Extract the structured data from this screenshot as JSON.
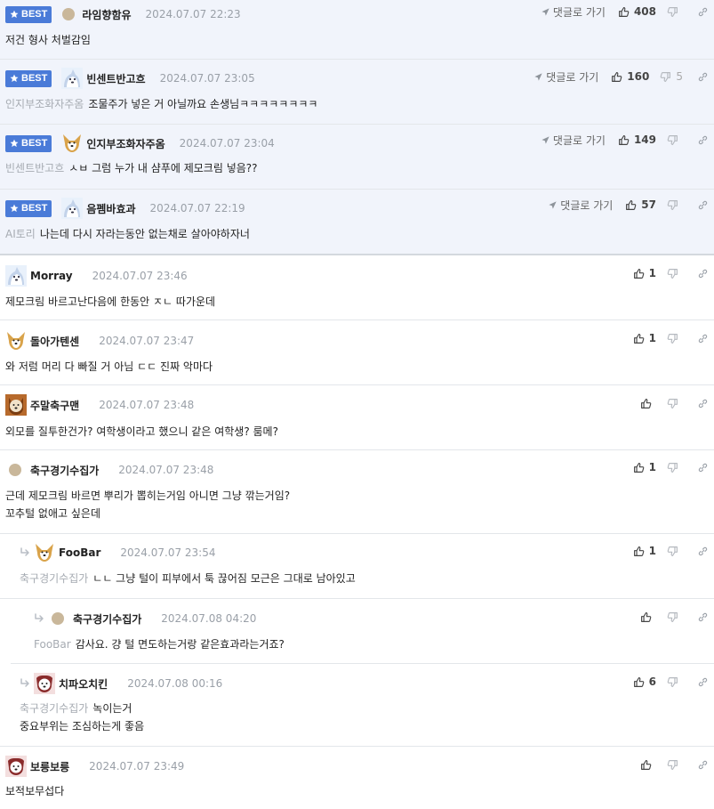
{
  "labels": {
    "best": "BEST",
    "reply_to": "댓글로 가기"
  },
  "colors": {
    "best_bg": "#f1f4fb",
    "best_badge": "#4a7bd8",
    "mention": "#a6abb2",
    "date": "#9aa0a8"
  },
  "comments": [
    {
      "best": true,
      "avatar": "dot-avatar",
      "nick": "라임향함유",
      "date": "2024.07.07 22:23",
      "likes": "408",
      "dislikes": "",
      "mention": "",
      "text": "저건 형사 처벌감임"
    },
    {
      "best": true,
      "avatar": "dog-white-icon",
      "nick": "빈센트반고흐",
      "date": "2024.07.07 23:05",
      "likes": "160",
      "dislikes": "5",
      "mention": "인지부조화자주옴",
      "text": "조물주가 넣은 거 아닐까요 손생님ㅋㅋㅋㅋㅋㅋㅋㅋ"
    },
    {
      "best": true,
      "avatar": "dog-yellow-icon",
      "nick": "인지부조화자주옴",
      "date": "2024.07.07 23:04",
      "likes": "149",
      "dislikes": "",
      "mention": "빈센트반고흐",
      "text": "ㅅㅂ 그럼 누가 내 샴푸에 제모크림 넣음??"
    },
    {
      "best": true,
      "avatar": "dog-white-icon",
      "nick": "음펨바효과",
      "date": "2024.07.07 22:19",
      "likes": "57",
      "dislikes": "",
      "mention": "AI토리",
      "text": "나는데 다시 자라는동안 없는채로 살아야하자너"
    },
    {
      "best": false,
      "avatar": "dog-white-icon",
      "nick": "Morray",
      "date": "2024.07.07 23:46",
      "likes": "1",
      "mention": "",
      "text": "제모크림 바르고난다음에 한동안 ㅈㄴ 따가운데"
    },
    {
      "best": false,
      "avatar": "dog-yellow-icon",
      "nick": "돌아가텐센",
      "date": "2024.07.07 23:47",
      "likes": "1",
      "mention": "",
      "text": "와 저럼 머리 다 빠질 거 아님 ㄷㄷ 진짜 악마다"
    },
    {
      "best": false,
      "avatar": "dog-brown-icon",
      "nick": "주말축구맨",
      "date": "2024.07.07 23:48",
      "likes": "",
      "mention": "",
      "text": "외모를 질투한건가? 여학생이라고 했으니 같은 여학생? 룸메?"
    },
    {
      "best": false,
      "avatar": "dot-avatar",
      "nick": "축구경기수집가",
      "date": "2024.07.07 23:48",
      "likes": "1",
      "mention": "",
      "text": "근데 제모크림 바르면 뿌리가 뽑히는거임 아니면 그냥 깎는거임?\n꼬추털 없애고 싶은데"
    },
    {
      "best": false,
      "avatar": "dog-yellow-icon",
      "nick": "FooBar",
      "date": "2024.07.07 23:54",
      "likes": "1",
      "mention": "축구경기수집가",
      "text": "ㄴㄴ 그냥 털이 피부에서 툭 끊어짐 모근은 그대로 남아있고"
    },
    {
      "best": false,
      "avatar": "dot-avatar",
      "nick": "축구경기수집가",
      "date": "2024.07.08 04:20",
      "likes": "",
      "mention": "FooBar",
      "text": "감사요. 걍 털 면도하는거랑 같은효과라는거죠?"
    },
    {
      "best": false,
      "avatar": "dog-red-icon",
      "nick": "치파오치킨",
      "date": "2024.07.08 00:16",
      "likes": "6",
      "mention": "축구경기수집가",
      "text": "녹이는거\n중요부위는 조심하는게 좋음"
    },
    {
      "best": false,
      "avatar": "dog-red-icon",
      "nick": "보릉보릉",
      "date": "2024.07.07 23:49",
      "likes": "",
      "mention": "",
      "text": "보적보무섭다"
    }
  ]
}
